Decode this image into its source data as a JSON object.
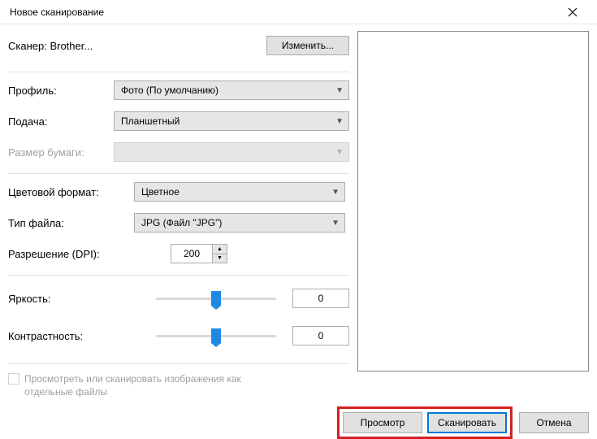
{
  "window": {
    "title": "Новое сканирование"
  },
  "scanner": {
    "label": "Сканер: Brother...",
    "change": "Изменить..."
  },
  "profile": {
    "label": "Профиль:",
    "value": "Фото (По умолчанию)"
  },
  "source": {
    "label": "Подача:",
    "value": "Планшетный"
  },
  "paper": {
    "label": "Размер бумаги:",
    "value": ""
  },
  "colorfmt": {
    "label": "Цветовой формат:",
    "value": "Цветное"
  },
  "filetype": {
    "label": "Тип файла:",
    "value": "JPG (Файл \"JPG\")"
  },
  "dpi": {
    "label": "Разрешение (DPI):",
    "value": "200"
  },
  "brightness": {
    "label": "Яркость:",
    "value": "0"
  },
  "contrast": {
    "label": "Контрастность:",
    "value": "0"
  },
  "separate": {
    "label": "Просмотреть или сканировать изображения как отдельные файлы"
  },
  "footer": {
    "preview": "Просмотр",
    "scan": "Сканировать",
    "cancel": "Отмена"
  }
}
